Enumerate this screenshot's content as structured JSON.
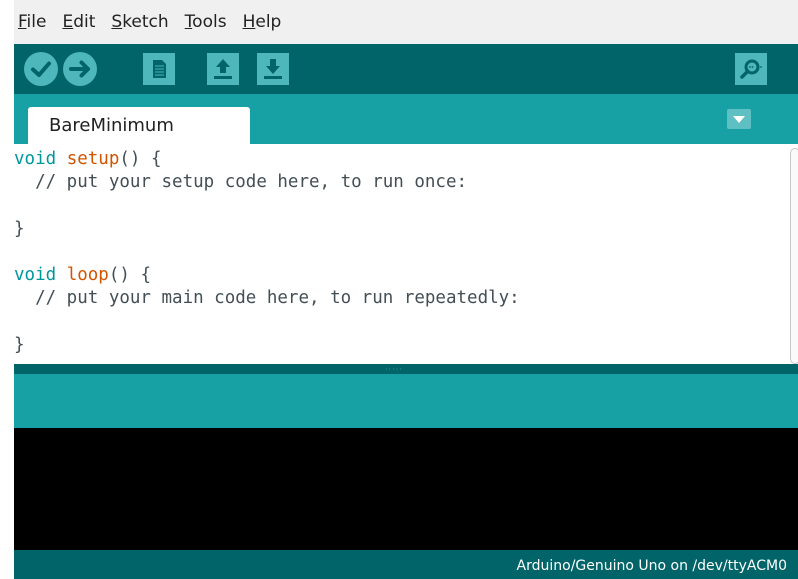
{
  "menu": [
    "File",
    "Edit",
    "Sketch",
    "Tools",
    "Help"
  ],
  "toolbar": {
    "icons": [
      "verify-icon",
      "upload-icon",
      "new-icon",
      "open-icon",
      "save-icon",
      "serial-monitor-icon"
    ]
  },
  "tab": {
    "label": "BareMinimum"
  },
  "code": {
    "l1_kw": "void",
    "l1_fn": "setup",
    "l1_rest": "() {",
    "l2": "  // put your setup code here, to run once:",
    "l4": "}",
    "l6_kw": "void",
    "l6_fn": "loop",
    "l6_rest": "() {",
    "l7": "  // put your main code here, to run repeatedly:",
    "l9": "}"
  },
  "status": {
    "board": "Arduino/Genuino Uno on /dev/ttyACM0"
  },
  "colors": {
    "toolbar": "#006468",
    "tabstrip": "#17a1a5",
    "button_fill": "#4db7bb",
    "keyword": "#00979c",
    "function": "#d35400"
  }
}
